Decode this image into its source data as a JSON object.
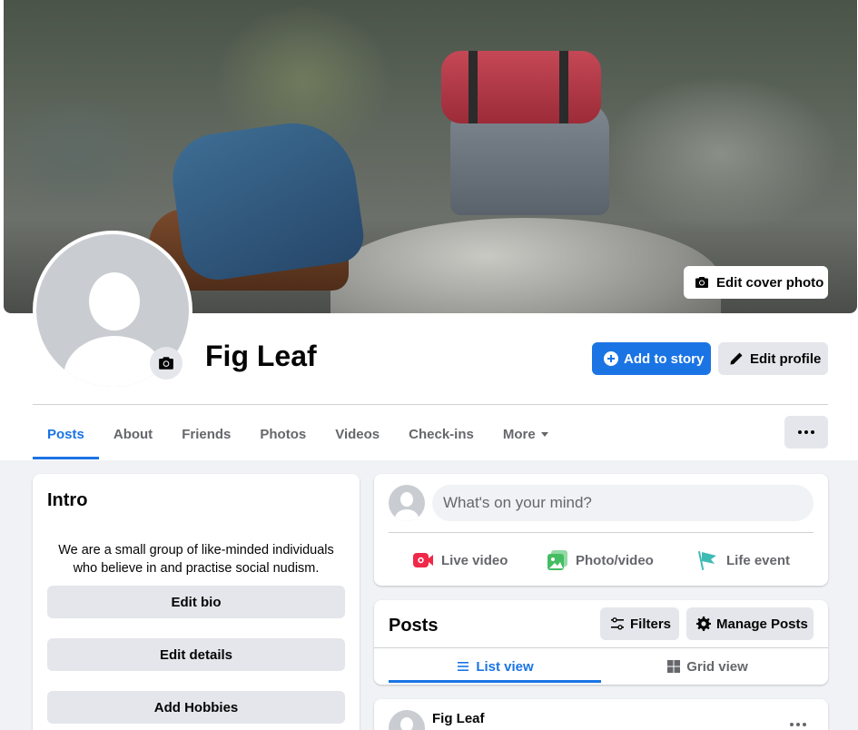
{
  "profile": {
    "name": "Fig Leaf"
  },
  "cover": {
    "edit_label": "Edit cover photo",
    "icon": "camera-icon"
  },
  "actions": {
    "add_story_label": "Add to story",
    "edit_profile_label": "Edit profile"
  },
  "tabs": [
    {
      "label": "Posts",
      "active": true
    },
    {
      "label": "About"
    },
    {
      "label": "Friends"
    },
    {
      "label": "Photos"
    },
    {
      "label": "Videos"
    },
    {
      "label": "Check-ins"
    },
    {
      "label": "More"
    }
  ],
  "intro": {
    "title": "Intro",
    "bio": "We are a small group of like-minded individuals who believe in and practise social nudism.",
    "buttons": [
      "Edit bio",
      "Edit details",
      "Add Hobbies"
    ]
  },
  "composer": {
    "placeholder": "What's on your mind?",
    "actions": [
      {
        "label": "Live video",
        "icon": "live-video-icon",
        "color": "#f02849"
      },
      {
        "label": "Photo/video",
        "icon": "photo-icon",
        "color": "#45bd62"
      },
      {
        "label": "Life event",
        "icon": "flag-icon",
        "color": "#3ebbb4"
      }
    ]
  },
  "posts_section": {
    "title": "Posts",
    "filters_label": "Filters",
    "manage_label": "Manage Posts",
    "views": [
      {
        "label": "List view",
        "active": true
      },
      {
        "label": "Grid view"
      }
    ]
  },
  "post": {
    "author": "Fig Leaf"
  },
  "colors": {
    "accent": "#1b74e4",
    "background": "#f0f2f5",
    "button_grey": "#e4e6eb"
  }
}
